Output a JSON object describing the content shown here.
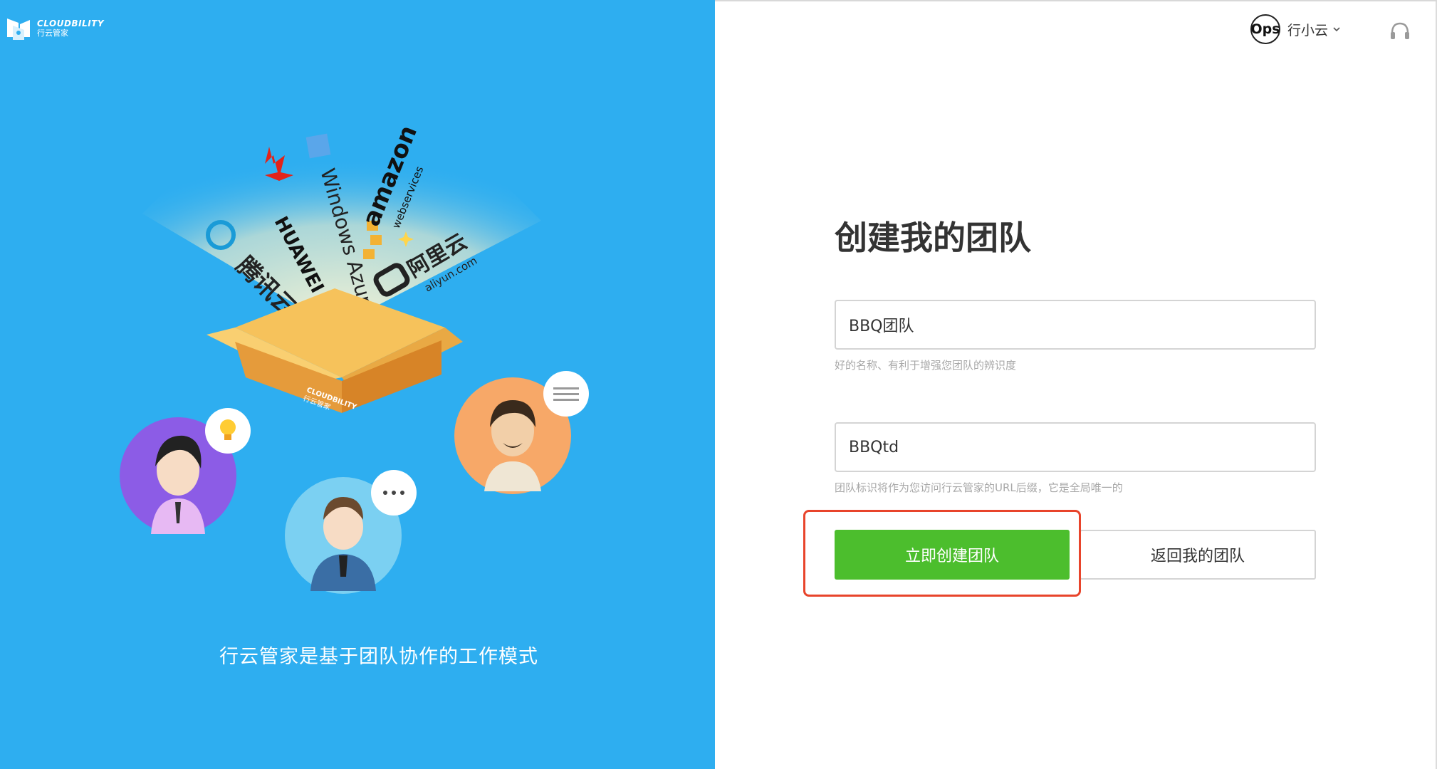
{
  "brand": {
    "name_en": "CLOUDBILITY",
    "name_cn": "行云管家",
    "logo_icon": "cloudbility-logo-icon"
  },
  "illustration": {
    "providers": [
      "腾讯云",
      "HUAWEI",
      "Windows Azure",
      "amazon",
      "webservices",
      "阿里云",
      "aliyun.com"
    ],
    "box_label": "CLOUDBILITY",
    "box_label_cn": "行云管家"
  },
  "left": {
    "caption": "行云管家是基于团队协作的工作模式"
  },
  "header": {
    "avatar_text": "Ops",
    "username": "行小云",
    "menu_icon": "chevron-down-icon",
    "support_icon": "headset-icon"
  },
  "form": {
    "title": "创建我的团队",
    "team_name": {
      "value": "BBQ团队",
      "hint": "好的名称、有利于增强您团队的辨识度"
    },
    "team_id": {
      "value": "BBQtd",
      "hint": "团队标识将作为您访问行云管家的URL后缀，它是全局唯一的"
    },
    "create_button": "立即创建团队",
    "back_button": "返回我的团队"
  },
  "colors": {
    "left_bg": "#2eaef0",
    "primary_green": "#4cbe2d",
    "highlight_red": "#e8442b"
  }
}
